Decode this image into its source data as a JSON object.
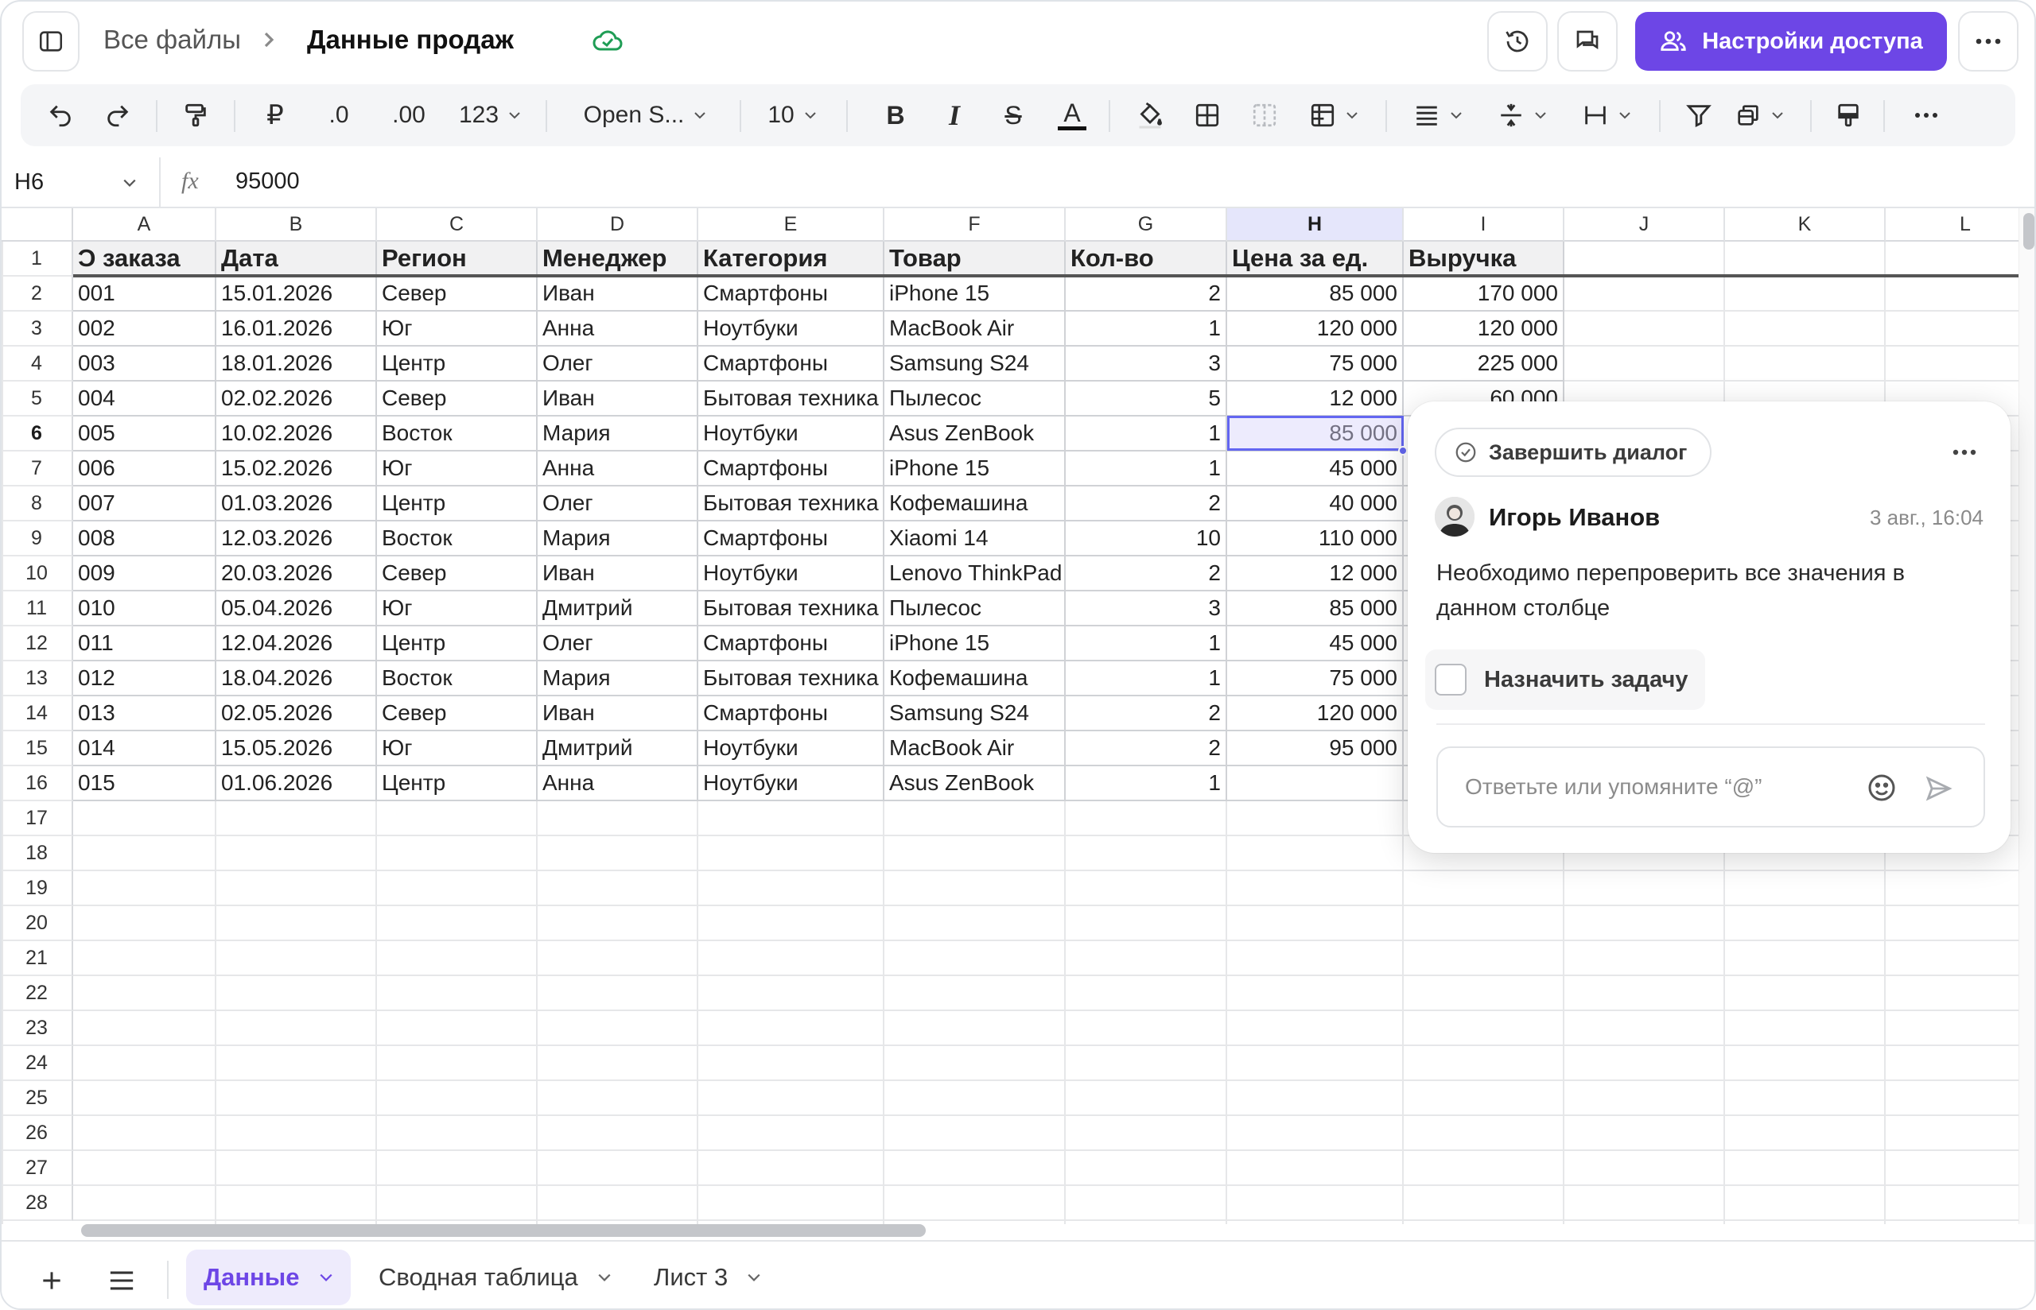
{
  "breadcrumb": {
    "parent": "Все файлы",
    "title": "Данные продаж"
  },
  "header": {
    "access_label": "Настройки доступа"
  },
  "toolbar": {
    "currency_symbol": "₽",
    "decimal_decrease": ".0",
    "decimal_increase": ".00",
    "number_format": "123",
    "font_name": "Open S...",
    "font_size": "10"
  },
  "formula_bar": {
    "cell_ref": "H6",
    "fx": "fx",
    "value": "95000"
  },
  "grid": {
    "columns": [
      "A",
      "B",
      "C",
      "D",
      "E",
      "F",
      "G",
      "H",
      "I",
      "J",
      "K",
      "L"
    ],
    "selected_column": "H",
    "selected_row": "6",
    "row_numbers": [
      "1",
      "2",
      "3",
      "4",
      "5",
      "6",
      "7",
      "8",
      "9",
      "10",
      "11",
      "12",
      "13",
      "14",
      "15",
      "16",
      "17",
      "18",
      "19",
      "20",
      "21",
      "22",
      "23",
      "24",
      "25",
      "26",
      "27",
      "28"
    ],
    "header_row": [
      "Ɔ заказа",
      "Дата",
      "Регион",
      "Менеджер",
      "Категория",
      "Товар",
      "Кол-во",
      "Цена за ед.",
      "Выручка"
    ],
    "rows": [
      [
        "001",
        "15.01.2026",
        "Север",
        "Иван",
        "Смартфоны",
        "iPhone 15",
        "2",
        "85 000",
        "170 000"
      ],
      [
        "002",
        "16.01.2026",
        "Юг",
        "Анна",
        "Ноутбуки",
        "MacBook Air",
        "1",
        "120 000",
        "120 000"
      ],
      [
        "003",
        "18.01.2026",
        "Центр",
        "Олег",
        "Смартфоны",
        "Samsung S24",
        "3",
        "75 000",
        "225 000"
      ],
      [
        "004",
        "02.02.2026",
        "Север",
        "Иван",
        "Бытовая техника",
        "Пылесос",
        "5",
        "12 000",
        "60 000"
      ],
      [
        "005",
        "10.02.2026",
        "Восток",
        "Мария",
        "Ноутбуки",
        "Asus ZenBook",
        "1",
        "85 000",
        ""
      ],
      [
        "006",
        "15.02.2026",
        "Юг",
        "Анна",
        "Смартфоны",
        "iPhone 15",
        "1",
        "45 000",
        ""
      ],
      [
        "007",
        "01.03.2026",
        "Центр",
        "Олег",
        "Бытовая техника",
        "Кофемашина",
        "2",
        "40 000",
        ""
      ],
      [
        "008",
        "12.03.2026",
        "Восток",
        "Мария",
        "Смартфоны",
        "Xiaomi 14",
        "10",
        "110 000",
        ""
      ],
      [
        "009",
        "20.03.2026",
        "Север",
        "Иван",
        "Ноутбуки",
        "Lenovo ThinkPad",
        "2",
        "12 000",
        ""
      ],
      [
        "010",
        "05.04.2026",
        "Юг",
        "Дмитрий",
        "Бытовая техника",
        "Пылесос",
        "3",
        "85 000",
        ""
      ],
      [
        "011",
        "12.04.2026",
        "Центр",
        "Олег",
        "Смартфоны",
        "iPhone 15",
        "1",
        "45 000",
        ""
      ],
      [
        "012",
        "18.04.2026",
        "Восток",
        "Мария",
        "Бытовая техника",
        "Кофемашина",
        "1",
        "75 000",
        ""
      ],
      [
        "013",
        "02.05.2026",
        "Север",
        "Иван",
        "Смартфоны",
        "Samsung S24",
        "2",
        "120 000",
        ""
      ],
      [
        "014",
        "15.05.2026",
        "Юг",
        "Дмитрий",
        "Ноутбуки",
        "MacBook Air",
        "2",
        "95 000",
        ""
      ],
      [
        "015",
        "01.06.2026",
        "Центр",
        "Анна",
        "Ноутбуки",
        "Asus ZenBook",
        "1",
        "",
        ""
      ]
    ]
  },
  "comment": {
    "resolve_label": "Завершить диалог",
    "author": "Игорь Иванов",
    "timestamp": "3 авг., 16:04",
    "text": "Необходимо перепроверить все значения в данном столбце",
    "assign_label": "Назначить задачу",
    "reply_placeholder": "Ответьте или упомяните “@”"
  },
  "sheets": {
    "tabs": [
      {
        "label": "Данные",
        "active": true
      },
      {
        "label": "Сводная таблица",
        "active": false
      },
      {
        "label": "Лист 3",
        "active": false
      }
    ]
  },
  "colors": {
    "accent": "#6d46e6",
    "selection": "#6366f1",
    "cloud_ok": "#1f9d55"
  }
}
